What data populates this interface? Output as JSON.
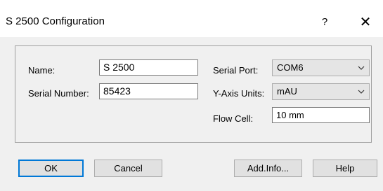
{
  "window": {
    "title": "S 2500 Configuration",
    "help_glyph": "?",
    "close_glyph": "✕"
  },
  "form": {
    "name_label": "Name:",
    "name_value": "S 2500",
    "serial_number_label": "Serial Number:",
    "serial_number_value": "85423",
    "serial_port_label": "Serial Port:",
    "serial_port_value": "COM6",
    "y_axis_units_label": "Y-Axis Units:",
    "y_axis_units_value": "mAU",
    "flow_cell_label": "Flow Cell:",
    "flow_cell_value": "10 mm"
  },
  "buttons": {
    "ok": "OK",
    "cancel": "Cancel",
    "add_info": "Add.Info...",
    "help": "Help"
  },
  "colors": {
    "dialog_bg": "#f0f0f0",
    "titlebar_bg": "#ffffff",
    "focus_border": "#0078d7"
  }
}
